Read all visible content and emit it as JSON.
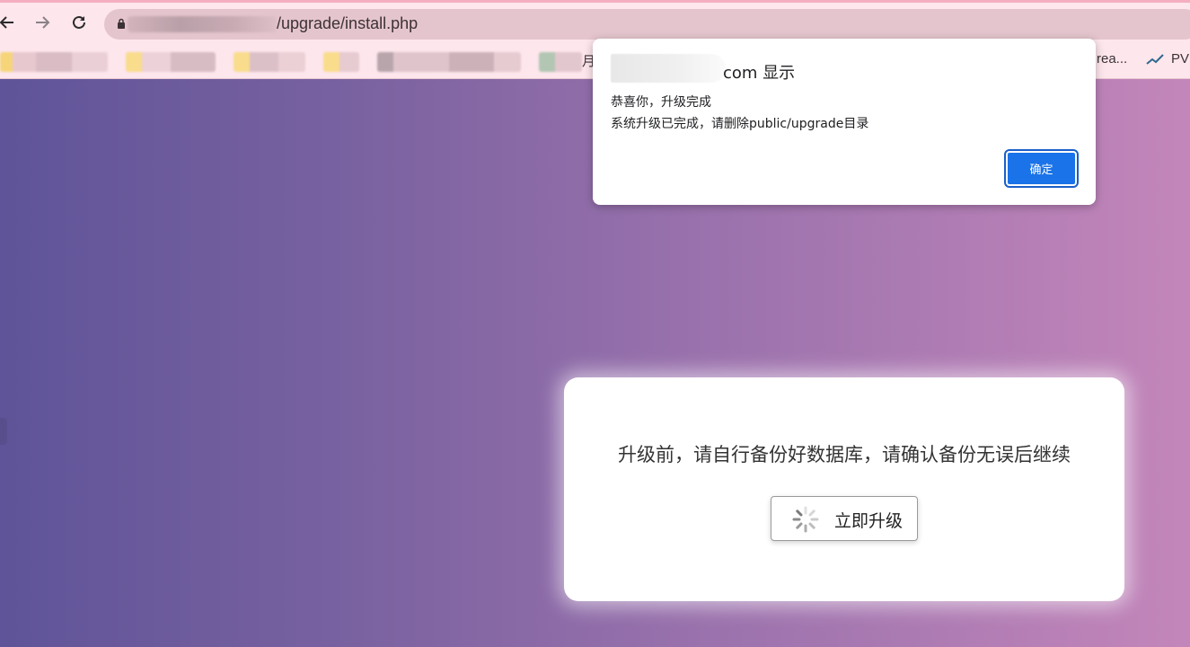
{
  "browser": {
    "url_path": "/upgrade/install.php",
    "bookmark_partial_1": "月",
    "bookmark_partial_2": "rea...",
    "bookmark_pv": "PV"
  },
  "alert": {
    "origin_suffix": "com 显示",
    "message_line1": "恭喜你，升级完成",
    "message_line2": "系统升级已完成，请删除public/upgrade目录",
    "ok_label": "确定"
  },
  "card": {
    "notice": "升级前，请自行备份好数据库，请确认备份无误后继续",
    "upgrade_label": "立即升级"
  },
  "colors": {
    "accent": "#1a73e8",
    "chrome": "#fde6ec"
  }
}
